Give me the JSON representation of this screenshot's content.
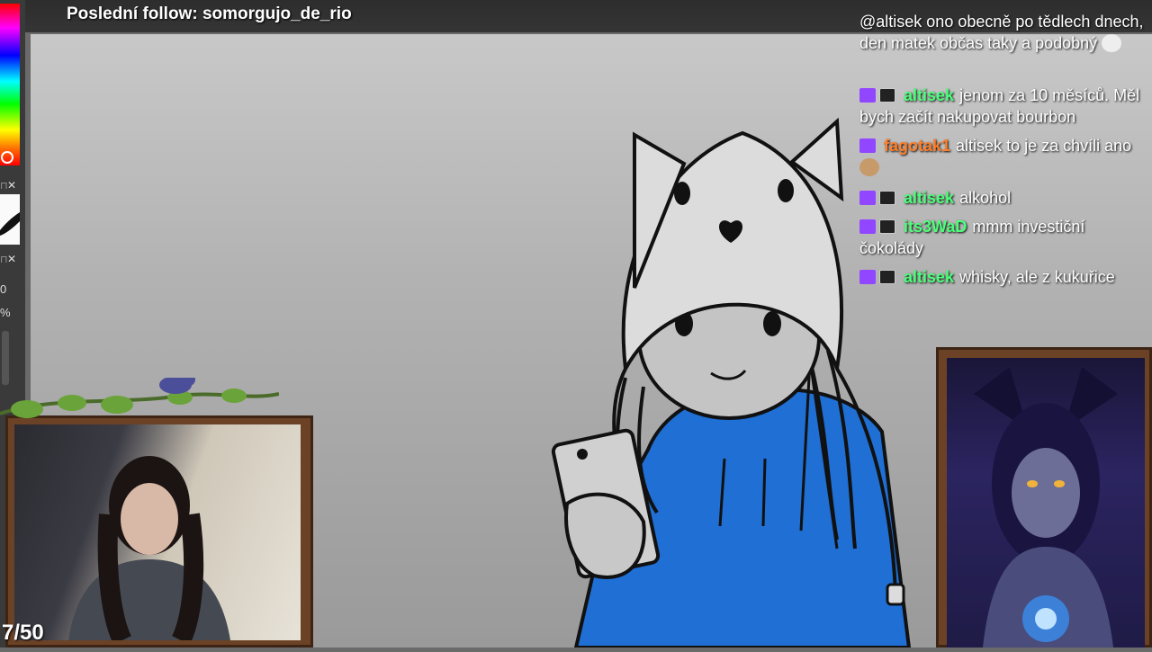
{
  "overlay": {
    "follow_text": "Poslední follow: somorgujo_de_rio",
    "counter": "7/50"
  },
  "tools": {
    "labels": [
      "0",
      "%"
    ]
  },
  "chat": {
    "messages": [
      {
        "user": "",
        "color": "#ffffff",
        "text": "@altisek ono obecně po tědlech dnech, den matek občas taky a podobný",
        "badges": [],
        "emote": "smile-emote"
      },
      {
        "user": "altisek",
        "color": "#4cff7a",
        "text": "jenom za 10 měsíců. Měl bych začít nakupovat bourbon",
        "badges": [
          "sub",
          "bits"
        ]
      },
      {
        "user": "fagotak1",
        "color": "#ff7f2a",
        "text": "altisek to je za chvíli ano",
        "badges": [
          "sub"
        ],
        "emote": "face-emote"
      },
      {
        "user": "altisek",
        "color": "#4cff7a",
        "text": "alkohol",
        "badges": [
          "sub",
          "bits"
        ]
      },
      {
        "user": "its3WaD",
        "color": "#4cff7a",
        "text": "mmm investiční čokolády",
        "badges": [
          "sub",
          "bits"
        ]
      },
      {
        "user": "altisek",
        "color": "#4cff7a",
        "text": "whisky, ale z kukuřice",
        "badges": [
          "sub",
          "bits"
        ]
      }
    ]
  },
  "colors": {
    "hoodie": "#1f6fd4",
    "sub_badge": "#9146ff",
    "green_user": "#4cff7a",
    "orange_user": "#ff7f2a"
  }
}
